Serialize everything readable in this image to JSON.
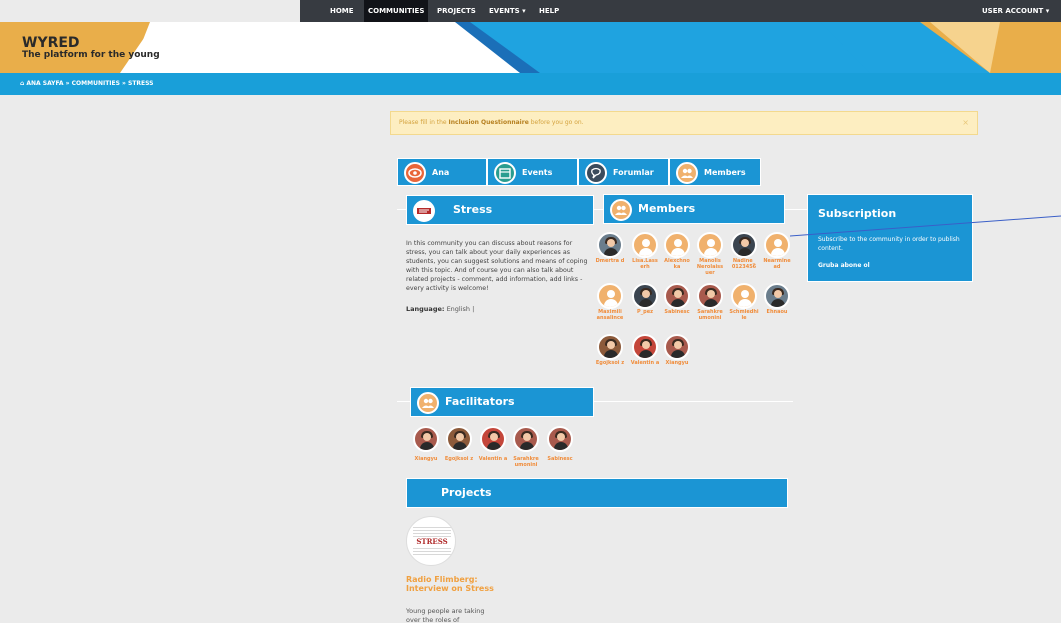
{
  "nav": {
    "items": [
      "HOME",
      "COMMUNITIES",
      "PROJECTS",
      "EVENTS ▾",
      "HELP"
    ],
    "account": "USER ACCOUNT ▾"
  },
  "brand": {
    "title": "WYRED",
    "subtitle": "The platform for the young"
  },
  "breadcrumb": "⌂ ANA SAYFA » COMMUNITIES » STRESS",
  "notice": {
    "before": "Please fill in the ",
    "link": "Inclusion Questionnaire",
    "after": " before you go on.",
    "close": "×"
  },
  "tabs": [
    {
      "label": "Ana",
      "icon": "eye-icon"
    },
    {
      "label": "Events",
      "icon": "calendar-icon"
    },
    {
      "label": "Forumlar",
      "icon": "forum-icon"
    },
    {
      "label": "Members",
      "icon": "people-icon"
    }
  ],
  "community": {
    "name": "Stress",
    "description": "In this community you can discuss about reasons for stress, you can talk about your daily experiences as students, you can suggest solutions and means of coping with this topic. And of course you can also talk about related projects - comment, add information, add links - every activity is welcome!",
    "language_label": "Language:",
    "language_value": "English |"
  },
  "members": {
    "title": "Members",
    "rows": [
      [
        "Dmertra d",
        "Lisa.Lass erh",
        "Alexchno ka",
        "Manolis Nerolaiss uer",
        "Nadine_ 0123456",
        "Nearmine ad"
      ],
      [
        "Maximili ansalince",
        "P_pez",
        "Sabinesc",
        "Sarahkre umonini",
        "Schmiedhi le",
        "Ehnaou"
      ],
      [
        "Egojksoi z",
        "Valentin a",
        "Xiangyu"
      ]
    ]
  },
  "facilitators": {
    "title": "Facilitators",
    "names": [
      "Xiangyu",
      "Egojksoi z",
      "Valentin a",
      "Sarahkre umonini",
      "Sabinesc"
    ]
  },
  "subscription": {
    "title": "Subscription",
    "text": "Subscribe to the community in order to publish content.",
    "link": "Gruba abone ol"
  },
  "projects": {
    "title": "Projects",
    "thumb_word": "STRESS",
    "item_title": "Radio Flimberg: Interview on Stress",
    "item_desc": "Young people are taking over the roles of"
  },
  "colors": {
    "blue": "#1b95d4",
    "accent_orange": "#f0b16d",
    "topnav": "#373b41"
  }
}
